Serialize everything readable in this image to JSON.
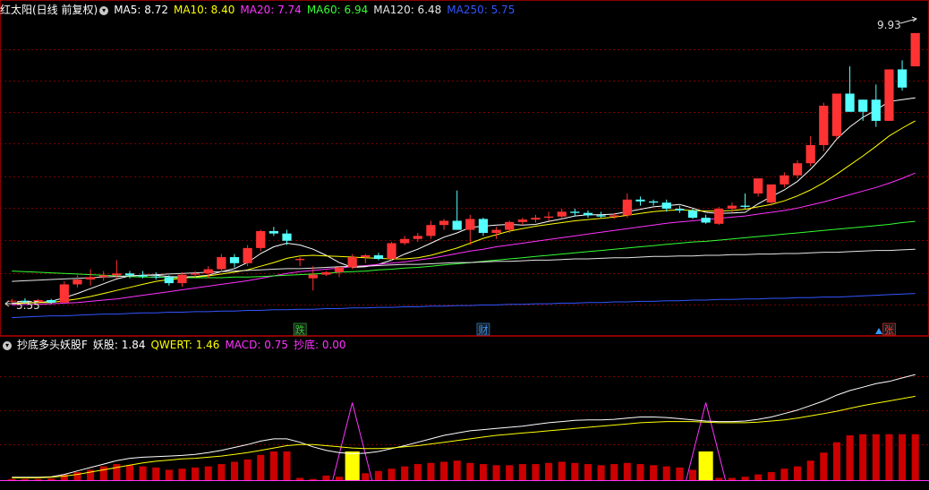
{
  "main_header": {
    "title": "红太阳(日线 前复权)",
    "ma": [
      {
        "label": "MA5: 8.72",
        "color": "#ffffff"
      },
      {
        "label": "MA10: 8.40",
        "color": "#ffff00"
      },
      {
        "label": "MA20: 7.74",
        "color": "#ff33ff"
      },
      {
        "label": "MA60: 6.94",
        "color": "#33ff33"
      },
      {
        "label": "MA120: 6.48",
        "color": "#e6e6e6"
      },
      {
        "label": "MA250: 5.75",
        "color": "#3355ff"
      }
    ]
  },
  "sub_header": {
    "title": "抄底多头妖股F",
    "items": [
      {
        "label": "妖股: 1.84",
        "color": "#ffffff"
      },
      {
        "label": "QWERT: 1.46",
        "color": "#ffff00"
      },
      {
        "label": "MACD: 0.75",
        "color": "#ff33ff"
      },
      {
        "label": "抄底: 0.00",
        "color": "#ff33ff"
      }
    ]
  },
  "colors": {
    "up": "#ff3333",
    "down": "#55ffff",
    "grid": "#7a0000",
    "panel_border": "#8b0000"
  },
  "chart_data": [
    {
      "type": "candlestick",
      "panel": "main",
      "ylim": [
        5.3,
        10.3
      ],
      "annotations": {
        "high_label": "9.93",
        "low_label": "5.55"
      },
      "markers": [
        {
          "label": "跌",
          "index": 22,
          "color": "#33cc33"
        },
        {
          "label": "财",
          "index": 36,
          "color": "#3399ff"
        },
        {
          "label": "张",
          "index": 67,
          "color": "#ff3333"
        }
      ],
      "ohlc": [
        [
          5.62,
          5.66,
          5.58,
          5.63
        ],
        [
          5.63,
          5.67,
          5.58,
          5.61
        ],
        [
          5.61,
          5.66,
          5.58,
          5.64
        ],
        [
          5.64,
          5.66,
          5.58,
          5.6
        ],
        [
          5.6,
          5.95,
          5.6,
          5.9
        ],
        [
          5.9,
          6.05,
          5.85,
          5.98
        ],
        [
          5.98,
          6.15,
          5.88,
          6.02
        ],
        [
          6.02,
          6.12,
          5.96,
          6.05
        ],
        [
          6.05,
          6.3,
          6.0,
          6.08
        ],
        [
          6.08,
          6.12,
          6.0,
          6.05
        ],
        [
          6.05,
          6.12,
          6.0,
          6.03
        ],
        [
          6.03,
          6.1,
          5.98,
          6.02
        ],
        [
          6.02,
          6.05,
          5.88,
          5.92
        ],
        [
          5.92,
          6.1,
          5.86,
          6.06
        ],
        [
          6.06,
          6.12,
          6.02,
          6.08
        ],
        [
          6.08,
          6.2,
          6.0,
          6.15
        ],
        [
          6.15,
          6.4,
          6.1,
          6.35
        ],
        [
          6.35,
          6.4,
          6.18,
          6.25
        ],
        [
          6.25,
          6.55,
          6.2,
          6.5
        ],
        [
          6.5,
          6.8,
          6.45,
          6.78
        ],
        [
          6.78,
          6.85,
          6.7,
          6.74
        ],
        [
          6.74,
          6.8,
          6.55,
          6.62
        ],
        [
          6.3,
          6.35,
          6.2,
          6.32
        ],
        [
          6.0,
          6.2,
          5.8,
          6.06
        ],
        [
          6.06,
          6.12,
          6.04,
          6.1
        ],
        [
          6.1,
          6.2,
          6.02,
          6.18
        ],
        [
          6.18,
          6.4,
          6.15,
          6.35
        ],
        [
          6.35,
          6.4,
          6.25,
          6.38
        ],
        [
          6.38,
          6.42,
          6.3,
          6.32
        ],
        [
          6.32,
          6.6,
          6.28,
          6.58
        ],
        [
          6.58,
          6.7,
          6.55,
          6.65
        ],
        [
          6.65,
          6.75,
          6.6,
          6.7
        ],
        [
          6.7,
          6.95,
          6.65,
          6.88
        ],
        [
          6.88,
          6.98,
          6.8,
          6.95
        ],
        [
          6.95,
          7.45,
          6.8,
          6.8
        ],
        [
          6.8,
          7.05,
          6.55,
          6.98
        ],
        [
          6.98,
          7.0,
          6.7,
          6.75
        ],
        [
          6.75,
          6.85,
          6.65,
          6.8
        ],
        [
          6.8,
          6.95,
          6.75,
          6.93
        ],
        [
          6.93,
          7.0,
          6.88,
          6.97
        ],
        [
          6.97,
          7.05,
          6.92,
          7.0
        ],
        [
          7.0,
          7.1,
          6.95,
          7.02
        ],
        [
          7.02,
          7.15,
          6.98,
          7.1
        ],
        [
          7.1,
          7.15,
          7.02,
          7.08
        ],
        [
          7.08,
          7.12,
          7.0,
          7.04
        ],
        [
          7.04,
          7.1,
          7.0,
          7.02
        ],
        [
          7.02,
          7.08,
          6.98,
          7.04
        ],
        [
          7.04,
          7.4,
          7.0,
          7.3
        ],
        [
          7.3,
          7.35,
          7.2,
          7.27
        ],
        [
          7.27,
          7.3,
          7.2,
          7.25
        ],
        [
          7.25,
          7.3,
          7.1,
          7.15
        ],
        [
          7.15,
          7.2,
          7.08,
          7.12
        ],
        [
          7.12,
          7.15,
          6.98,
          7.0
        ],
        [
          7.0,
          7.05,
          6.9,
          6.92
        ],
        [
          6.9,
          7.18,
          6.88,
          7.15
        ],
        [
          7.15,
          7.25,
          7.08,
          7.2
        ],
        [
          7.2,
          7.4,
          7.15,
          7.18
        ],
        [
          7.4,
          7.6,
          7.35,
          7.65
        ],
        [
          7.25,
          7.55,
          7.2,
          7.55
        ],
        [
          7.55,
          7.75,
          7.5,
          7.7
        ],
        [
          7.7,
          7.95,
          7.65,
          7.9
        ],
        [
          7.9,
          8.35,
          7.85,
          8.2
        ],
        [
          8.2,
          8.9,
          8.1,
          8.85
        ],
        [
          8.35,
          9.05,
          8.3,
          9.05
        ],
        [
          9.05,
          9.5,
          8.75,
          8.75
        ],
        [
          8.95,
          8.95,
          8.6,
          8.75
        ],
        [
          8.95,
          9.2,
          8.5,
          8.6
        ],
        [
          8.6,
          9.45,
          8.6,
          9.45
        ],
        [
          9.45,
          9.6,
          9.1,
          9.15
        ],
        [
          9.5,
          10.05,
          9.5,
          10.05
        ]
      ],
      "ma_series": [
        {
          "name": "MA5",
          "color": "#ffffff",
          "values": [
            5.59,
            5.6,
            5.6,
            5.62,
            5.68,
            5.75,
            5.83,
            5.91,
            5.99,
            6.04,
            6.05,
            6.05,
            6.03,
            6.02,
            6.03,
            6.05,
            6.11,
            6.16,
            6.26,
            6.41,
            6.52,
            6.58,
            6.55,
            6.48,
            6.38,
            6.26,
            6.18,
            6.19,
            6.23,
            6.3,
            6.4,
            6.48,
            6.58,
            6.68,
            6.75,
            6.84,
            6.86,
            6.88,
            6.89,
            6.88,
            6.89,
            6.94,
            6.98,
            7.03,
            7.05,
            7.05,
            7.06,
            7.1,
            7.14,
            7.18,
            7.2,
            7.22,
            7.16,
            7.09,
            7.07,
            7.08,
            7.09,
            7.23,
            7.35,
            7.46,
            7.6,
            7.8,
            8.03,
            8.3,
            8.5,
            8.66,
            8.78,
            8.92,
            8.95,
            8.98
          ]
        },
        {
          "name": "MA10",
          "color": "#ffff00",
          "values": [
            5.58,
            5.59,
            5.6,
            5.6,
            5.63,
            5.66,
            5.7,
            5.75,
            5.8,
            5.85,
            5.9,
            5.95,
            5.98,
            6.0,
            6.02,
            6.04,
            6.07,
            6.1,
            6.14,
            6.2,
            6.26,
            6.33,
            6.37,
            6.38,
            6.37,
            6.36,
            6.35,
            6.34,
            6.33,
            6.32,
            6.32,
            6.34,
            6.38,
            6.44,
            6.5,
            6.58,
            6.66,
            6.72,
            6.78,
            6.82,
            6.86,
            6.89,
            6.92,
            6.95,
            6.97,
            6.99,
            7.01,
            7.04,
            7.07,
            7.1,
            7.12,
            7.13,
            7.12,
            7.11,
            7.11,
            7.12,
            7.14,
            7.18,
            7.22,
            7.28,
            7.36,
            7.46,
            7.58,
            7.72,
            7.87,
            8.02,
            8.18,
            8.35,
            8.48,
            8.6
          ]
        },
        {
          "name": "MA20",
          "color": "#ff33ff",
          "values": [
            5.56,
            5.57,
            5.57,
            5.58,
            5.59,
            5.6,
            5.62,
            5.64,
            5.66,
            5.69,
            5.72,
            5.75,
            5.78,
            5.81,
            5.84,
            5.87,
            5.9,
            5.93,
            5.96,
            6.0,
            6.04,
            6.08,
            6.11,
            6.13,
            6.15,
            6.17,
            6.19,
            6.21,
            6.23,
            6.25,
            6.27,
            6.3,
            6.33,
            6.37,
            6.41,
            6.45,
            6.48,
            6.52,
            6.55,
            6.58,
            6.61,
            6.64,
            6.67,
            6.7,
            6.73,
            6.76,
            6.79,
            6.82,
            6.85,
            6.88,
            6.91,
            6.93,
            6.95,
            6.97,
            6.99,
            7.01,
            7.03,
            7.06,
            7.09,
            7.12,
            7.16,
            7.21,
            7.26,
            7.32,
            7.38,
            7.44,
            7.5,
            7.57,
            7.65,
            7.74
          ]
        },
        {
          "name": "MA60",
          "color": "#33ff33",
          "values": [
            6.12,
            6.11,
            6.1,
            6.09,
            6.08,
            6.07,
            6.06,
            6.05,
            6.04,
            6.03,
            6.02,
            6.02,
            6.01,
            6.01,
            6.01,
            6.01,
            6.01,
            6.02,
            6.02,
            6.03,
            6.04,
            6.05,
            6.06,
            6.07,
            6.08,
            6.1,
            6.11,
            6.12,
            6.14,
            6.15,
            6.17,
            6.18,
            6.2,
            6.22,
            6.24,
            6.26,
            6.28,
            6.3,
            6.32,
            6.34,
            6.36,
            6.38,
            6.4,
            6.42,
            6.44,
            6.46,
            6.48,
            6.5,
            6.52,
            6.54,
            6.56,
            6.58,
            6.6,
            6.61,
            6.63,
            6.65,
            6.67,
            6.69,
            6.71,
            6.73,
            6.75,
            6.77,
            6.79,
            6.81,
            6.83,
            6.85,
            6.87,
            6.89,
            6.92,
            6.94
          ]
        },
        {
          "name": "MA120",
          "color": "#e6e6e6",
          "values": [
            5.95,
            5.96,
            5.97,
            5.98,
            5.99,
            6.0,
            6.01,
            6.02,
            6.03,
            6.04,
            6.05,
            6.06,
            6.07,
            6.08,
            6.09,
            6.1,
            6.11,
            6.12,
            6.13,
            6.14,
            6.15,
            6.16,
            6.16,
            6.17,
            6.18,
            6.19,
            6.2,
            6.2,
            6.21,
            6.22,
            6.23,
            6.23,
            6.24,
            6.25,
            6.26,
            6.26,
            6.27,
            6.28,
            6.28,
            6.29,
            6.3,
            6.3,
            6.31,
            6.32,
            6.32,
            6.33,
            6.34,
            6.34,
            6.35,
            6.36,
            6.36,
            6.37,
            6.37,
            6.38,
            6.38,
            6.39,
            6.39,
            6.4,
            6.4,
            6.41,
            6.41,
            6.42,
            6.43,
            6.43,
            6.44,
            6.45,
            6.46,
            6.46,
            6.47,
            6.48
          ]
        },
        {
          "name": "MA250",
          "color": "#3355ff",
          "values": [
            5.35,
            5.36,
            5.37,
            5.38,
            5.38,
            5.39,
            5.4,
            5.41,
            5.41,
            5.42,
            5.43,
            5.43,
            5.44,
            5.44,
            5.45,
            5.45,
            5.46,
            5.46,
            5.47,
            5.47,
            5.48,
            5.48,
            5.49,
            5.49,
            5.5,
            5.5,
            5.51,
            5.51,
            5.52,
            5.52,
            5.53,
            5.53,
            5.54,
            5.54,
            5.55,
            5.55,
            5.56,
            5.56,
            5.57,
            5.57,
            5.58,
            5.58,
            5.59,
            5.59,
            5.6,
            5.6,
            5.61,
            5.61,
            5.62,
            5.62,
            5.63,
            5.63,
            5.64,
            5.64,
            5.65,
            5.65,
            5.66,
            5.66,
            5.67,
            5.67,
            5.68,
            5.68,
            5.69,
            5.69,
            5.7,
            5.71,
            5.72,
            5.73,
            5.74,
            5.75
          ]
        }
      ]
    },
    {
      "type": "bar+line",
      "panel": "indicator",
      "ylim": [
        0,
        2.2
      ],
      "bars": {
        "name": "MACD",
        "color": "#cc0000",
        "values": [
          0.02,
          0.02,
          0.02,
          0.03,
          0.1,
          0.14,
          0.18,
          0.24,
          0.28,
          0.26,
          0.24,
          0.22,
          0.18,
          0.2,
          0.22,
          0.24,
          0.28,
          0.32,
          0.36,
          0.44,
          0.5,
          0.5,
          0.04,
          0.02,
          0.08,
          0.06,
          0.1,
          0.12,
          0.16,
          0.2,
          0.24,
          0.28,
          0.3,
          0.32,
          0.34,
          0.3,
          0.28,
          0.26,
          0.26,
          0.28,
          0.28,
          0.3,
          0.32,
          0.3,
          0.28,
          0.26,
          0.28,
          0.3,
          0.28,
          0.26,
          0.24,
          0.22,
          0.18,
          0.12,
          0.04,
          0.04,
          0.06,
          0.1,
          0.14,
          0.2,
          0.24,
          0.34,
          0.48,
          0.66,
          0.78,
          0.8,
          0.8,
          0.8,
          0.8,
          0.8
        ]
      },
      "signal_bars": {
        "name": "抄底",
        "color": "#ffff00",
        "index": [
          26,
          53
        ],
        "values": [
          0.5,
          0.5
        ]
      },
      "spikes": {
        "name": "抄底",
        "color": "#ff33ff",
        "index": [
          26,
          53
        ],
        "value": 1.35
      },
      "series": [
        {
          "name": "妖股",
          "color": "#ffffff",
          "values": [
            0.05,
            0.05,
            0.05,
            0.06,
            0.1,
            0.16,
            0.22,
            0.28,
            0.34,
            0.38,
            0.4,
            0.41,
            0.42,
            0.43,
            0.45,
            0.48,
            0.52,
            0.57,
            0.62,
            0.68,
            0.72,
            0.72,
            0.66,
            0.58,
            0.52,
            0.48,
            0.46,
            0.47,
            0.5,
            0.55,
            0.6,
            0.66,
            0.72,
            0.78,
            0.82,
            0.86,
            0.88,
            0.9,
            0.92,
            0.94,
            0.97,
            1.0,
            1.02,
            1.04,
            1.05,
            1.05,
            1.06,
            1.08,
            1.1,
            1.1,
            1.09,
            1.07,
            1.05,
            1.03,
            1.02,
            1.02,
            1.03,
            1.06,
            1.1,
            1.16,
            1.22,
            1.3,
            1.38,
            1.48,
            1.56,
            1.62,
            1.68,
            1.72,
            1.78,
            1.84
          ]
        },
        {
          "name": "QWERT",
          "color": "#ffff00",
          "values": [
            0.04,
            0.04,
            0.04,
            0.05,
            0.07,
            0.1,
            0.14,
            0.18,
            0.22,
            0.26,
            0.3,
            0.33,
            0.35,
            0.37,
            0.38,
            0.4,
            0.42,
            0.45,
            0.48,
            0.52,
            0.56,
            0.6,
            0.62,
            0.62,
            0.6,
            0.58,
            0.56,
            0.55,
            0.55,
            0.56,
            0.58,
            0.6,
            0.63,
            0.66,
            0.69,
            0.72,
            0.75,
            0.78,
            0.8,
            0.82,
            0.84,
            0.86,
            0.88,
            0.9,
            0.92,
            0.94,
            0.96,
            0.98,
            1.0,
            1.01,
            1.02,
            1.02,
            1.02,
            1.01,
            1.0,
            1.0,
            1.0,
            1.01,
            1.03,
            1.05,
            1.08,
            1.12,
            1.16,
            1.2,
            1.25,
            1.3,
            1.34,
            1.38,
            1.42,
            1.46
          ]
        }
      ]
    }
  ]
}
